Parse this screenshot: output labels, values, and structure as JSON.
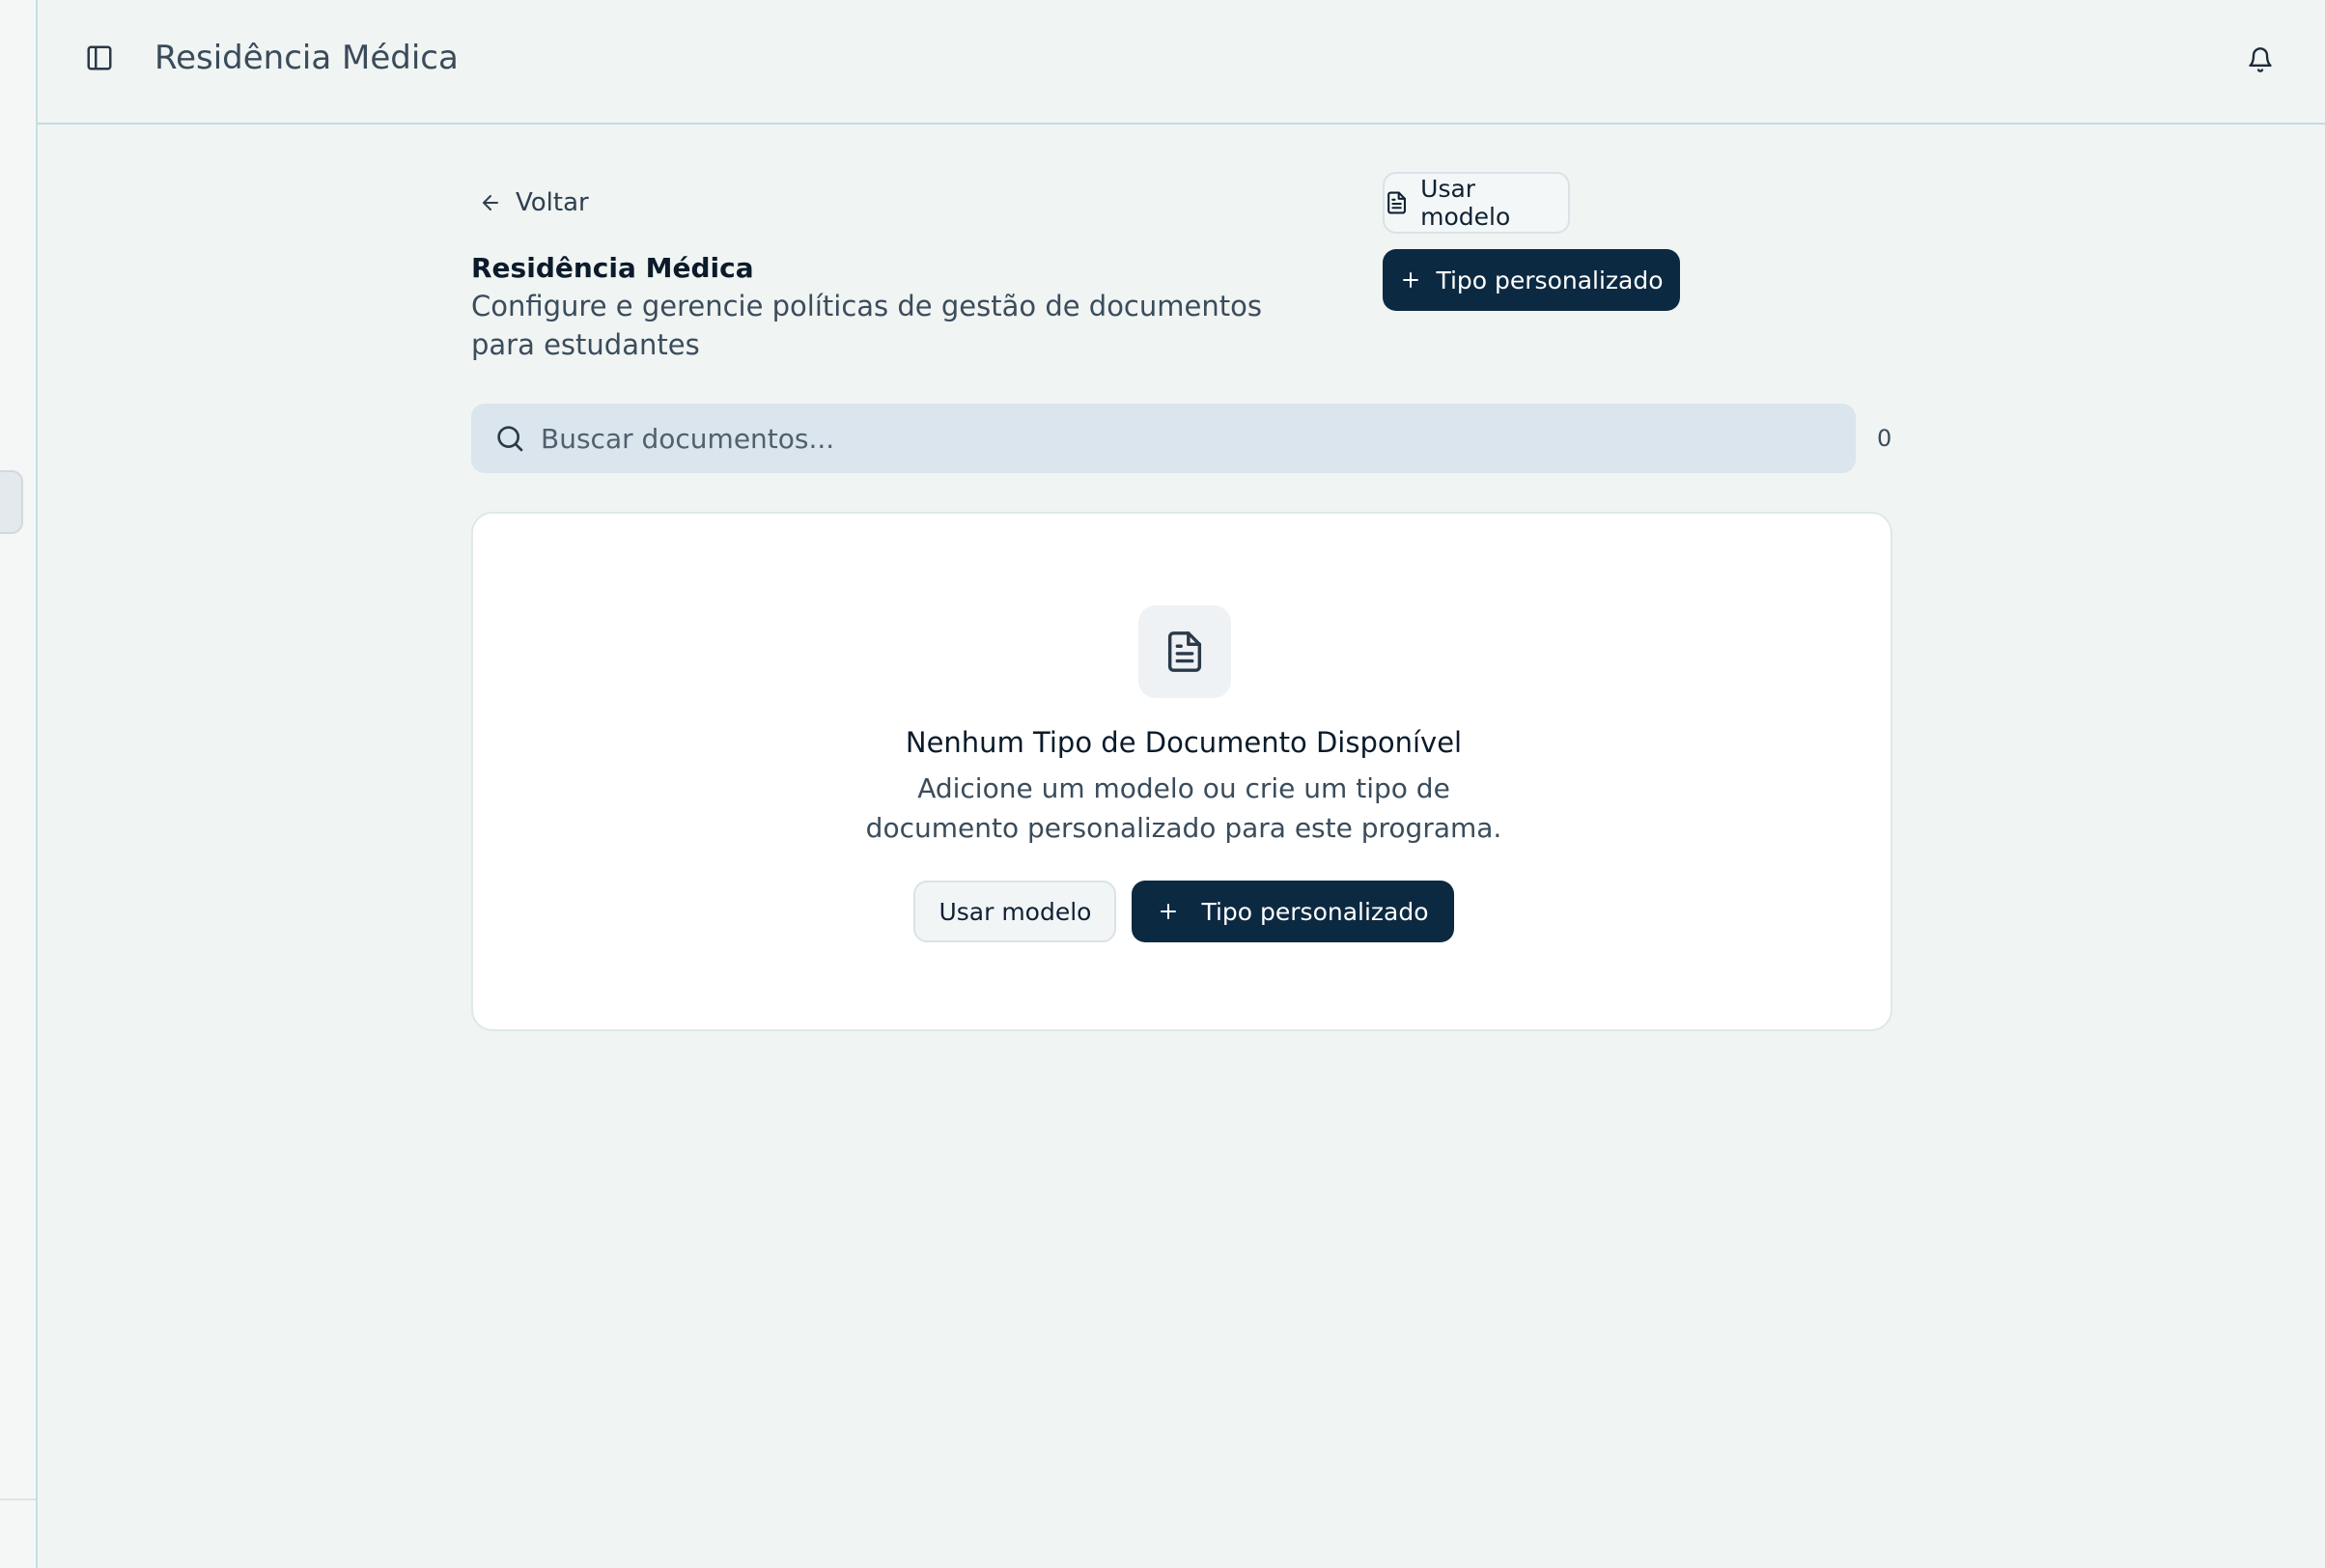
{
  "header": {
    "title": "Residência Médica",
    "sidebar_toggle_icon": "sidebar-toggle-icon",
    "notifications_icon": "bell-icon"
  },
  "page": {
    "back_label": "Voltar",
    "title": "Residência Médica",
    "subtitle": "Configure e gerencie políticas de gestão de documentos para estudantes",
    "use_template_label": "Usar modelo",
    "custom_type_label": "Tipo personalizado"
  },
  "search": {
    "placeholder": "Buscar documentos...",
    "value": "",
    "count": "0"
  },
  "empty_state": {
    "icon": "file-text-icon",
    "title": "Nenhum Tipo de Documento Disponível",
    "description": "Adicione um modelo ou crie um tipo de documento personalizado para este programa.",
    "use_template_label": "Usar modelo",
    "custom_type_label": "Tipo personalizado"
  },
  "colors": {
    "background": "#f0f4f3",
    "primary": "#0c2942",
    "search_bg": "#dbe5ee",
    "card_bg": "#ffffff"
  }
}
